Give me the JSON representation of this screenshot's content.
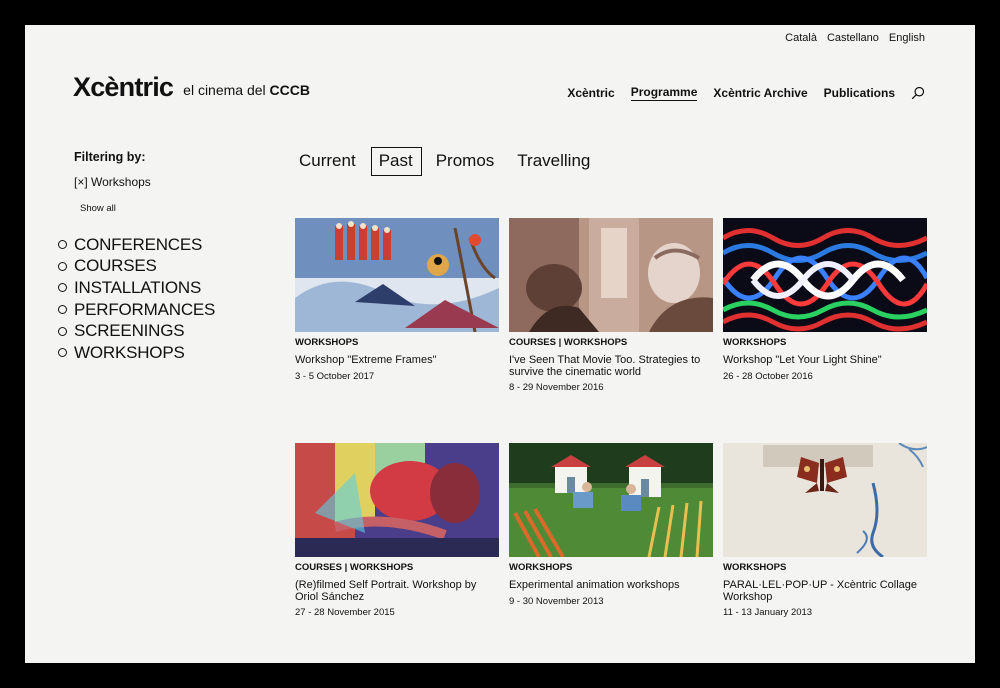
{
  "languages": [
    "Català",
    "Castellano",
    "English"
  ],
  "logo": {
    "mark": "Xcèntric",
    "tagline_prefix": "el cinema del",
    "tagline_bold": "CCCB"
  },
  "nav": {
    "items": [
      {
        "label": "Xcèntric",
        "active": false
      },
      {
        "label": "Programme",
        "active": true
      },
      {
        "label": "Xcèntric Archive",
        "active": false
      },
      {
        "label": "Publications",
        "active": false
      }
    ],
    "search_icon": "search-icon"
  },
  "sidebar": {
    "filter_title": "Filtering by:",
    "active_filter": "[×] Workshops",
    "show_all": "Show all",
    "categories": [
      "Conferences",
      "Courses",
      "Installations",
      "Performances",
      "Screenings",
      "Workshops"
    ]
  },
  "tabs": [
    {
      "label": "Current",
      "active": false
    },
    {
      "label": "Past",
      "active": true
    },
    {
      "label": "Promos",
      "active": false
    },
    {
      "label": "Travelling",
      "active": false
    }
  ],
  "cards": [
    {
      "category": "WORKSHOPS",
      "title": "Workshop \"Extreme Frames\"",
      "date": "3 - 5 October 2017"
    },
    {
      "category": "COURSES | WORKSHOPS",
      "title": "I've Seen That Movie Too. Strategies to survive the cinematic world",
      "date": "8 - 29 November 2016"
    },
    {
      "category": "WORKSHOPS",
      "title": "Workshop \"Let Your Light Shine\"",
      "date": "26 - 28 October 2016"
    },
    {
      "category": "COURSES | WORKSHOPS",
      "title": "(Re)filmed Self Portrait. Workshop by Oriol Sánchez",
      "date": "27 - 28 November 2015"
    },
    {
      "category": "WORKSHOPS",
      "title": "Experimental animation workshops",
      "date": "9 - 30 November 2013"
    },
    {
      "category": "WORKSHOPS",
      "title": "PARAL·LEL·POP·UP - Xcèntric Collage Workshop",
      "date": "11 - 13 January 2013"
    }
  ]
}
